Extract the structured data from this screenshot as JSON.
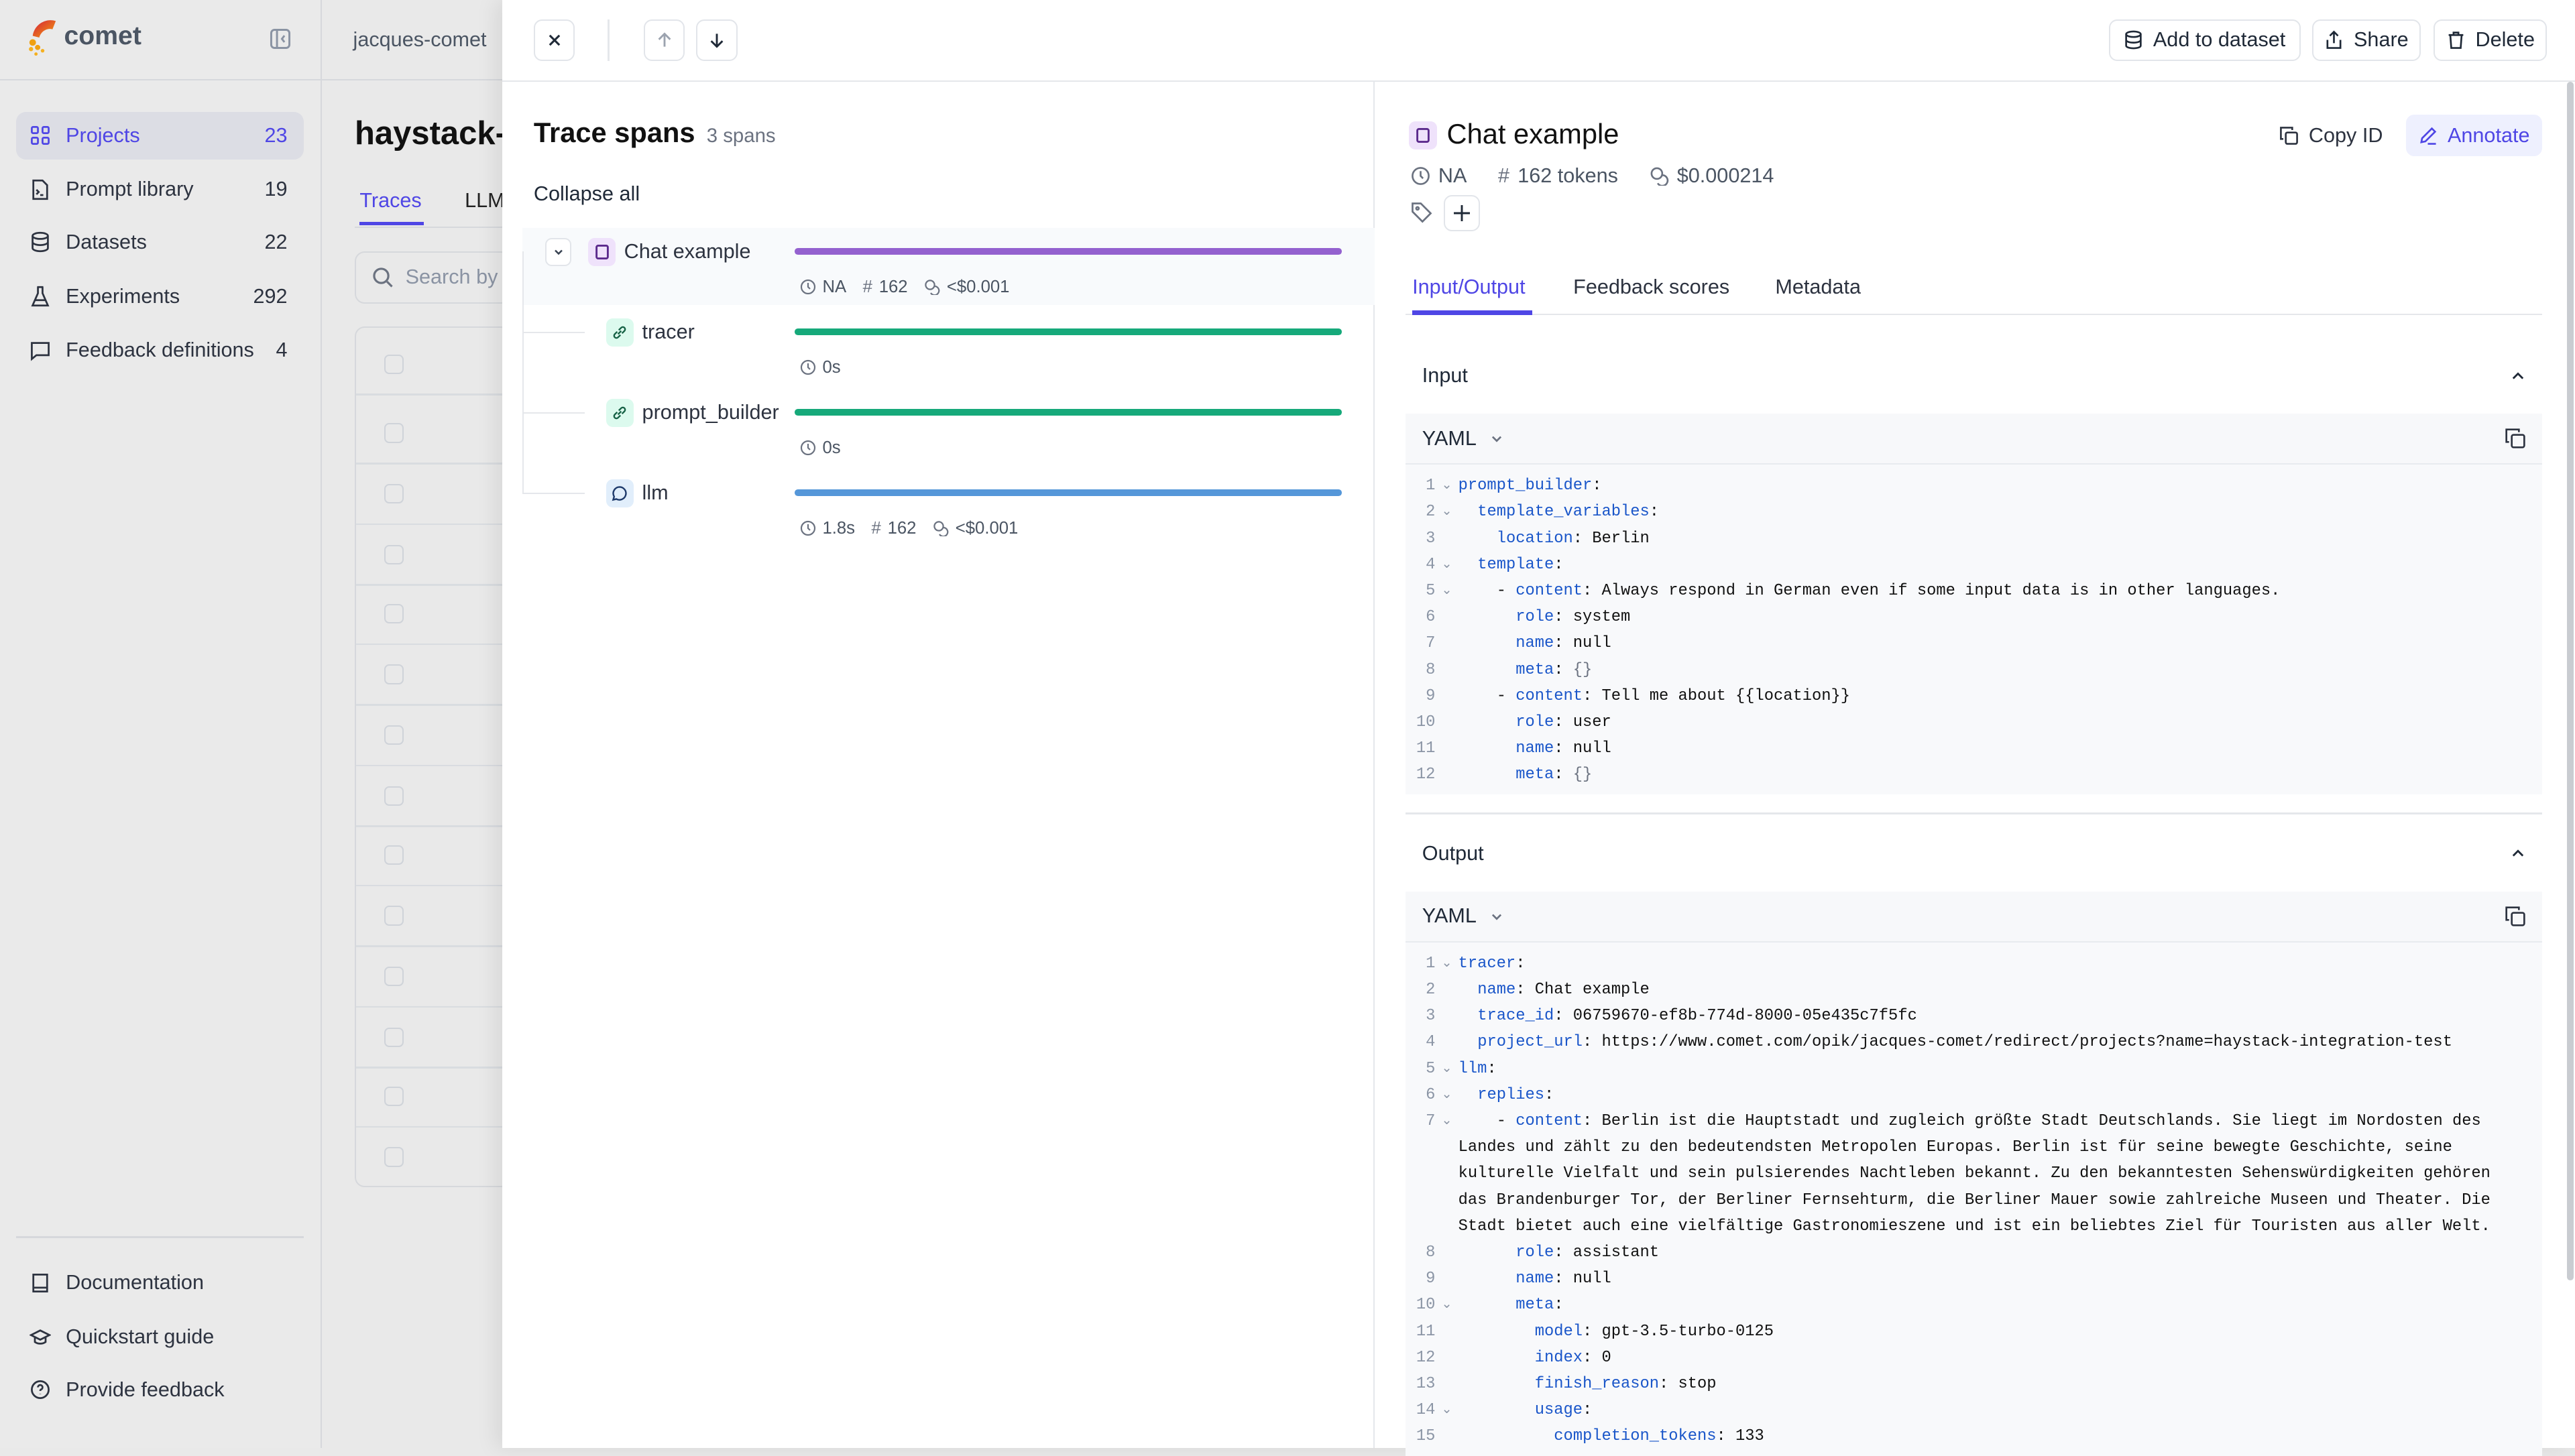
{
  "sidebar": {
    "brand": "comet",
    "nav": [
      {
        "label": "Projects",
        "count": "23",
        "icon": "grid-icon",
        "active": true
      },
      {
        "label": "Prompt library",
        "count": "19",
        "icon": "file-terminal-icon"
      },
      {
        "label": "Datasets",
        "count": "22",
        "icon": "database-icon"
      },
      {
        "label": "Experiments",
        "count": "292",
        "icon": "flask-icon"
      },
      {
        "label": "Feedback definitions",
        "count": "4",
        "icon": "message-square-icon"
      }
    ],
    "bottom": [
      {
        "label": "Documentation",
        "icon": "book-icon"
      },
      {
        "label": "Quickstart guide",
        "icon": "graduation-cap-icon"
      },
      {
        "label": "Provide feedback",
        "icon": "message-help-icon"
      }
    ]
  },
  "main": {
    "workspace": "jacques-comet",
    "project_title": "haystack-",
    "tabs": [
      "Traces",
      "LLM"
    ],
    "search_placeholder": "Search by"
  },
  "drawer": {
    "toolbar": {
      "add_to_dataset": "Add to dataset",
      "share": "Share",
      "delete": "Delete"
    },
    "spans": {
      "title": "Trace spans",
      "count": "3 spans",
      "collapse_all": "Collapse all",
      "items": [
        {
          "name": "Chat example",
          "type": "trace",
          "color": "#9461cf",
          "duration": "NA",
          "tokens": "162",
          "cost": "<$0.001"
        },
        {
          "name": "tracer",
          "type": "general",
          "color": "#16a97a",
          "duration": "0s"
        },
        {
          "name": "prompt_builder",
          "type": "general",
          "color": "#16a97a",
          "duration": "0s"
        },
        {
          "name": "llm",
          "type": "llm",
          "color": "#5597d9",
          "duration": "1.8s",
          "tokens": "162",
          "cost": "<$0.001"
        }
      ]
    },
    "detail": {
      "title": "Chat example",
      "copy_id": "Copy ID",
      "annotate": "Annotate",
      "duration": "NA",
      "tokens": "162 tokens",
      "cost": "$0.000214",
      "tabs": [
        "Input/Output",
        "Feedback scores",
        "Metadata"
      ],
      "input": {
        "label": "Input",
        "format": "YAML",
        "lines": [
          {
            "n": "1",
            "f": true,
            "pre": "",
            "k": "prompt_builder",
            "v": ""
          },
          {
            "n": "2",
            "f": true,
            "pre": "  ",
            "k": "template_variables",
            "v": ""
          },
          {
            "n": "3",
            "pre": "    ",
            "k": "location",
            "v": "Berlin"
          },
          {
            "n": "4",
            "f": true,
            "pre": "  ",
            "k": "template",
            "v": ""
          },
          {
            "n": "5",
            "f": true,
            "pre": "    - ",
            "k": "content",
            "v": "Always respond in German even if some input data is in other languages."
          },
          {
            "n": "6",
            "pre": "      ",
            "k": "role",
            "v": "system"
          },
          {
            "n": "7",
            "pre": "      ",
            "k": "name",
            "v": "null"
          },
          {
            "n": "8",
            "pre": "      ",
            "k": "meta",
            "v": "{}"
          },
          {
            "n": "9",
            "pre": "    - ",
            "k": "content",
            "v": "Tell me about {{location}}"
          },
          {
            "n": "10",
            "pre": "      ",
            "k": "role",
            "v": "user"
          },
          {
            "n": "11",
            "pre": "      ",
            "k": "name",
            "v": "null"
          },
          {
            "n": "12",
            "pre": "      ",
            "k": "meta",
            "v": "{}"
          }
        ]
      },
      "output": {
        "label": "Output",
        "format": "YAML",
        "lines": [
          {
            "n": "1",
            "f": true,
            "pre": "",
            "k": "tracer",
            "v": ""
          },
          {
            "n": "2",
            "pre": "  ",
            "k": "name",
            "v": "Chat example"
          },
          {
            "n": "3",
            "pre": "  ",
            "k": "trace_id",
            "v": "06759670-ef8b-774d-8000-05e435c7f5fc"
          },
          {
            "n": "4",
            "pre": "  ",
            "k": "project_url",
            "v": "https://www.comet.com/opik/jacques-comet/redirect/projects?name=haystack-integration-test"
          },
          {
            "n": "5",
            "f": true,
            "pre": "",
            "k": "llm",
            "v": ""
          },
          {
            "n": "6",
            "f": true,
            "pre": "  ",
            "k": "replies",
            "v": ""
          },
          {
            "n": "7",
            "f": true,
            "pre": "    - ",
            "k": "content",
            "v": "Berlin ist die Hauptstadt und zugleich größte Stadt Deutschlands. Sie liegt im Nordosten des Landes und zählt zu den bedeutendsten Metropolen Europas. Berlin ist für seine bewegte Geschichte, seine kulturelle Vielfalt und sein pulsierendes Nachtleben bekannt. Zu den bekanntesten Sehenswürdigkeiten gehören das Brandenburger Tor, der Berliner Fernsehturm, die Berliner Mauer sowie zahlreiche Museen und Theater. Die Stadt bietet auch eine vielfältige Gastronomieszene und ist ein beliebtes Ziel für Touristen aus aller Welt."
          },
          {
            "n": "8",
            "pre": "      ",
            "k": "role",
            "v": "assistant"
          },
          {
            "n": "9",
            "pre": "      ",
            "k": "name",
            "v": "null"
          },
          {
            "n": "10",
            "f": true,
            "pre": "      ",
            "k": "meta",
            "v": ""
          },
          {
            "n": "11",
            "pre": "        ",
            "k": "model",
            "v": "gpt-3.5-turbo-0125"
          },
          {
            "n": "12",
            "pre": "        ",
            "k": "index",
            "v": "0"
          },
          {
            "n": "13",
            "pre": "        ",
            "k": "finish_reason",
            "v": "stop"
          },
          {
            "n": "14",
            "f": true,
            "pre": "        ",
            "k": "usage",
            "v": ""
          },
          {
            "n": "15",
            "pre": "          ",
            "k": "completion_tokens",
            "v": "133"
          }
        ]
      }
    }
  },
  "colors": {
    "accent": "#4f46e5",
    "trace": "#9461cf",
    "general": "#16a97a",
    "llm": "#5597d9"
  }
}
